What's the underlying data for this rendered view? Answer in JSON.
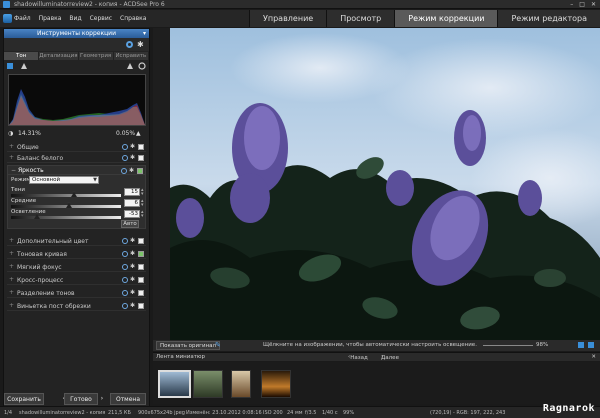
{
  "window": {
    "title": "shadowilluminatorreview2 - копия - ACDSee Pro 6",
    "controls": [
      "–",
      "□",
      "✕"
    ]
  },
  "menu": [
    "Файл",
    "Правка",
    "Вид",
    "Сервис",
    "Справка"
  ],
  "mode_tabs": [
    {
      "label": "Управление",
      "active": false
    },
    {
      "label": "Просмотр",
      "active": false
    },
    {
      "label": "Режим коррекции",
      "active": true
    },
    {
      "label": "Режим редактора",
      "active": false
    }
  ],
  "panel": {
    "title": "Инструменты коррекции",
    "subtabs": [
      "Тон",
      "Детализация",
      "Геометрия",
      "Исправить"
    ],
    "active_subtab": "Тон",
    "histogram": {
      "left_percent": "14.31%",
      "right_percent": "0.05%"
    },
    "sections_top": [
      {
        "label": "Общие"
      },
      {
        "label": "Баланс белого"
      }
    ],
    "brightness": {
      "label": "Яркость",
      "mode_label": "Режим",
      "mode_value": "Основной",
      "sliders": [
        {
          "label": "Тени",
          "value": "15",
          "level": 0.57
        },
        {
          "label": "Средние",
          "value": "6",
          "level": 0.53
        },
        {
          "label": "Осветление",
          "value": "-53",
          "level": 0.24
        }
      ],
      "auto_label": "Авто"
    },
    "sections_bottom": [
      {
        "label": "Дополнительный цвет"
      },
      {
        "label": "Тоновая кривая"
      },
      {
        "label": "Мягкий фокус"
      },
      {
        "label": "Кросс-процесс"
      },
      {
        "label": "Разделение тонов"
      },
      {
        "label": "Виньетка пост обрезки"
      }
    ],
    "buttons": {
      "save": "Сохранить",
      "done": "Готово",
      "cancel": "Отмена"
    }
  },
  "viewer": {
    "show_original": "Показать оригинал",
    "hint": "Щёлкните на изображении, чтобы автоматически настроить освещение.",
    "zoom": "98%"
  },
  "filmstrip": {
    "title": "Лента миниатюр",
    "back": "Назад",
    "forward": "Далее",
    "thumbs": 4
  },
  "statusbar": {
    "index": "1/4",
    "filename": "shadowilluminatorreview2 - копия",
    "size": "211,5 КБ",
    "dims": "900x675x24b jpeg",
    "modified": "Изменён: 23.10.2012 0:08:16",
    "iso": "ISO 200",
    "focal": "24 мм",
    "aperture": "f/3.5",
    "shutter": "1/40 с",
    "zoom": "99%",
    "coords": "(720,19) - RGB: 197, 222, 243"
  },
  "watermark": "Ragnarok",
  "colors": {
    "accent": "#3a8fd9",
    "active_tab": "#5a5a5a"
  }
}
